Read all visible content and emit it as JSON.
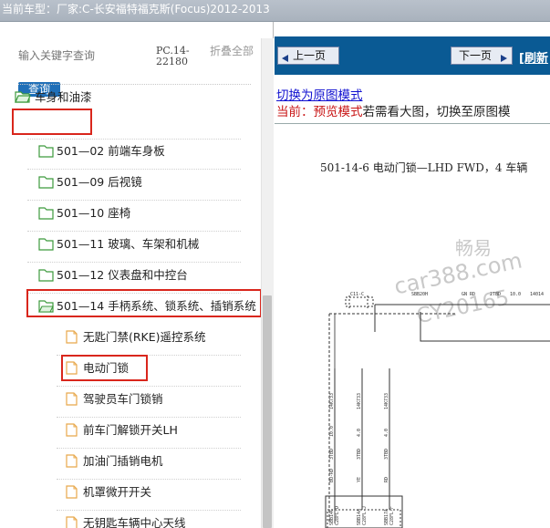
{
  "window": {
    "title_prefix": "当前车型：",
    "title_value": "厂家:C-长安福特福克斯(Focus)2012-2013"
  },
  "search": {
    "placeholder": "输入关键字查询",
    "button": "查询",
    "pc_code": "PC.14-22180",
    "collapse_all": "折叠全部"
  },
  "tree": {
    "root": "车身和油漆",
    "groups": [
      "501—02 前端车身板",
      "501—09 后视镜",
      "501—10 座椅",
      "501—11 玻璃、车架和机械",
      "501—12 仪表盘和中控台",
      "501—14 手柄系统、锁系统、插销系统"
    ],
    "docs": [
      "无匙门禁(RKE)遥控系统",
      "电动门锁",
      "驾驶员车门锁销",
      "前车门解锁开关LH",
      "加油门插销电机",
      "机罩微开开关",
      "无钥匙车辆中心天线"
    ]
  },
  "nav": {
    "prev": "上一页",
    "next": "下一页",
    "refresh": "[刷新"
  },
  "content": {
    "mode_link": "切换为原图模式",
    "current_label": "当前：",
    "current_mode": "预览模式",
    "current_hint": "若需看大图，切换至原图模",
    "diagram_title": "501-14-6 电动门锁—LHD FWD，4   车辆",
    "watermark_1": "畅易",
    "watermark_2": "car388.com",
    "watermark_3": "CY20165"
  },
  "diagram_labels": {
    "top_labels": [
      "C11-C",
      "SBB20H",
      "GN RD",
      "2TBD",
      "10.0",
      "14014"
    ],
    "wires_a": [
      "BU-RD",
      "3TBD",
      "10.0",
      "14K733"
    ],
    "wires_b": [
      "YE",
      "3TBD",
      "4.0",
      "14K733"
    ],
    "wires_c": [
      "RD",
      "3TBD",
      "4.0",
      "14K733"
    ],
    "bottom_a": [
      "SBB14C",
      "C28FL-D"
    ],
    "bottom_b": [
      "SBB14A",
      "C28FL-J"
    ],
    "bottom_c": [
      "SBB17A",
      "C28FL-F"
    ]
  },
  "colors": {
    "nav_bar": "#0a5a94",
    "search_button": "#1f6fb8",
    "highlight_box": "#d9261c",
    "folder_icon": "#3c9a3c",
    "doc_icon": "#e8a84b"
  }
}
